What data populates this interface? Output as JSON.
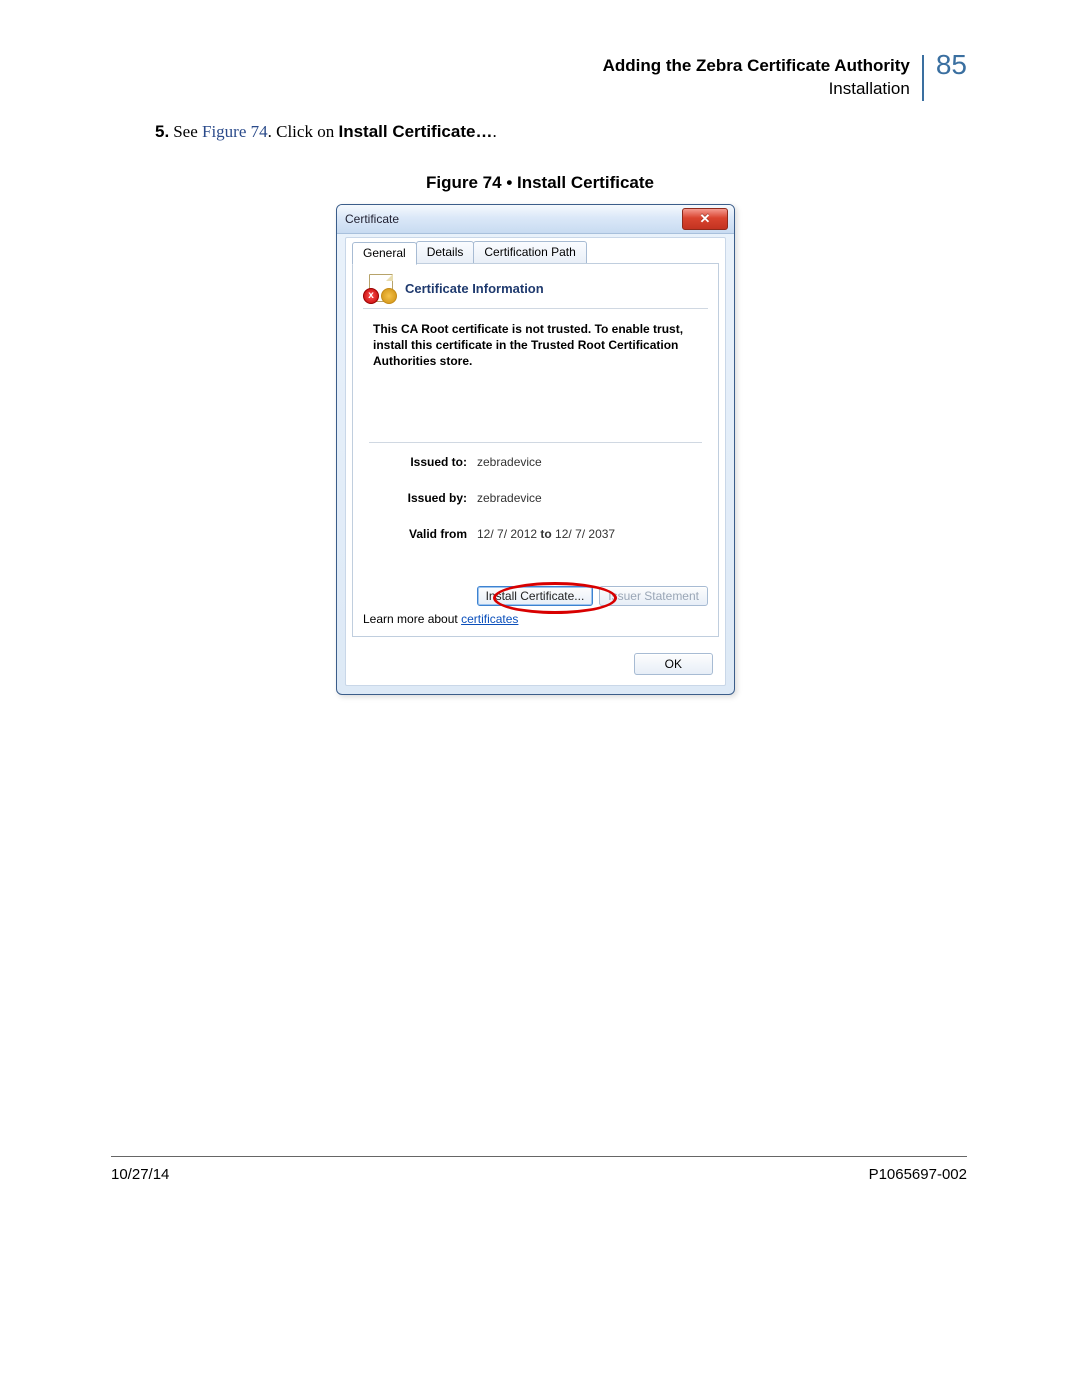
{
  "header": {
    "section_title": "Adding the Zebra Certificate Authority",
    "section_sub": "Installation",
    "page_number": "85"
  },
  "step": {
    "number": "5.",
    "see_text": "See ",
    "figure_ref": "Figure 74",
    "click_on": ". Click on ",
    "bold_action": "Install Certificate…",
    "period": "."
  },
  "figure": {
    "caption": "Figure 74 • Install Certificate"
  },
  "dialog": {
    "title": "Certificate",
    "close_glyph": "✕",
    "tabs": {
      "general": "General",
      "details": "Details",
      "path": "Certification Path"
    },
    "info_header": "Certificate Information",
    "info_body": "This CA Root certificate is not trusted. To enable trust, install this certificate in the Trusted Root Certification Authorities store.",
    "issued_to_label": "Issued to:",
    "issued_to_value": "zebradevice",
    "issued_by_label": "Issued by:",
    "issued_by_value": "zebradevice",
    "valid_from_label": "Valid from",
    "valid_from_value": " 12/ 7/ 2012 ",
    "valid_to_label": "to",
    "valid_to_value": " 12/ 7/ 2037",
    "install_btn": "Install Certificate...",
    "issuer_btn": "Issuer Statement",
    "learn_more_prefix": "Learn more about ",
    "learn_more_link": "certificates",
    "ok_btn": "OK",
    "badge_glyph": "x"
  },
  "footer": {
    "date": "10/27/14",
    "doc_number": "P1065697-002"
  }
}
